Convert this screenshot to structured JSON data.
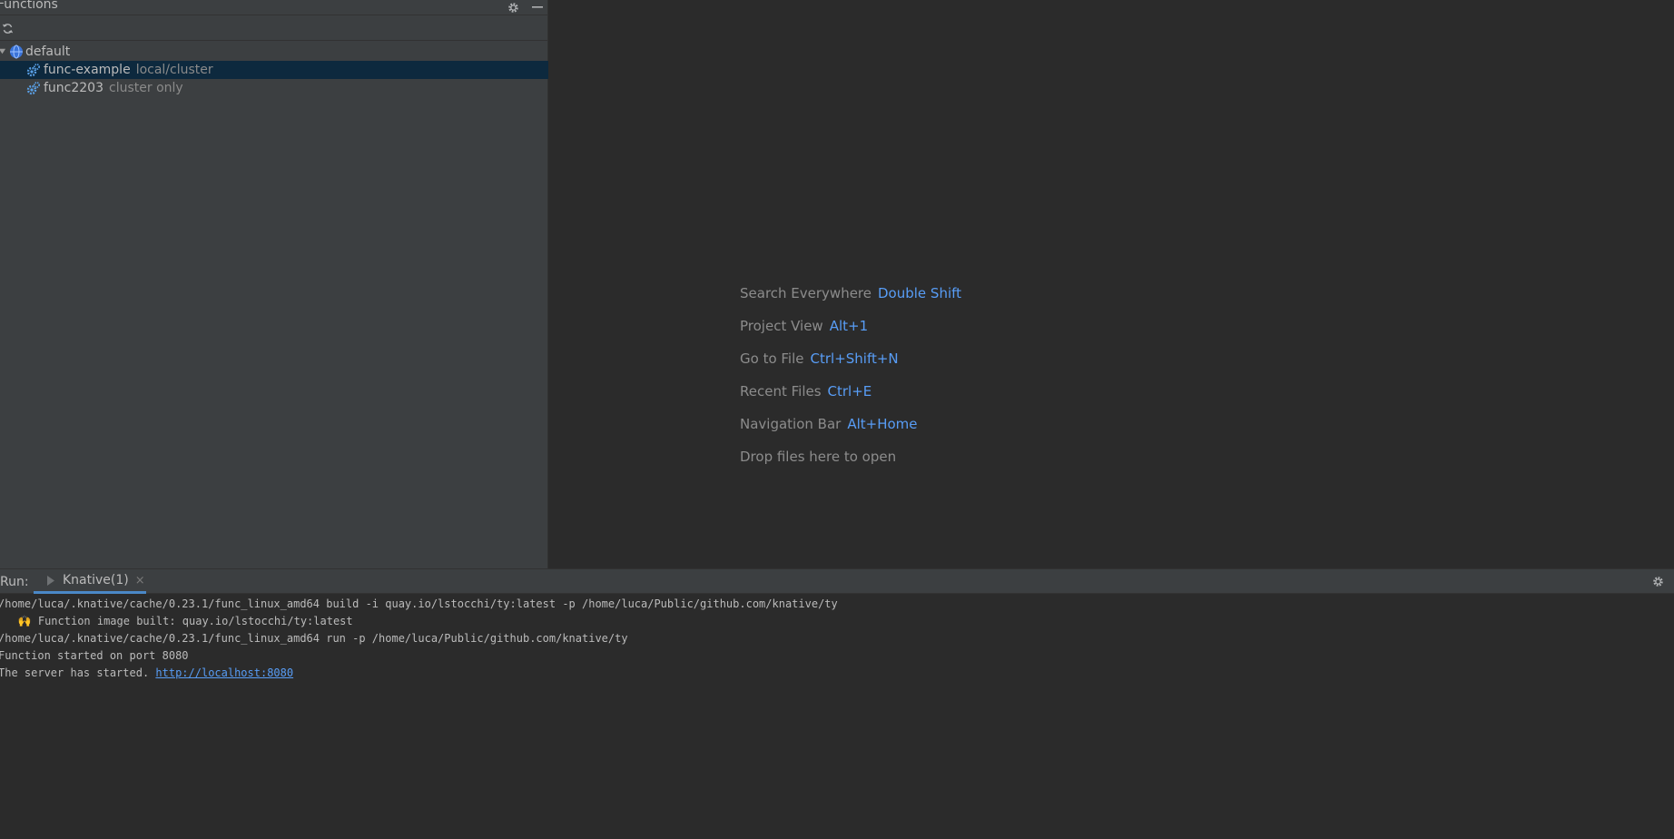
{
  "functions_panel": {
    "title": "Functions",
    "settings_icon": "gear-icon",
    "hide_icon": "minimize-icon",
    "toolbar": {
      "refresh_icon": "refresh-icon"
    },
    "tree": {
      "namespace": {
        "label": "default",
        "icon": "globe-icon",
        "expanded": true
      },
      "items": [
        {
          "label": "func-example",
          "hint": "local/cluster",
          "icon": "function-gear-icon",
          "selected": true
        },
        {
          "label": "func2203",
          "hint": "cluster only",
          "icon": "function-gear-icon",
          "selected": false
        }
      ]
    }
  },
  "editor_hints": [
    {
      "action": "Search Everywhere",
      "key": "Double Shift"
    },
    {
      "action": "Project View",
      "key": "Alt+1"
    },
    {
      "action": "Go to File",
      "key": "Ctrl+Shift+N"
    },
    {
      "action": "Recent Files",
      "key": "Ctrl+E"
    },
    {
      "action": "Navigation Bar",
      "key": "Alt+Home"
    },
    {
      "action": "Drop files here to open",
      "key": ""
    }
  ],
  "run_panel": {
    "label": "Run:",
    "tab": {
      "label": "Knative(1)",
      "icon": "run-icon",
      "close": "×"
    },
    "settings_icon": "gear-icon",
    "console": {
      "lines": [
        "/home/luca/.knative/cache/0.23.1/func_linux_amd64 build -i quay.io/lstocchi/ty:latest -p /home/luca/Public/github.com/knative/ty",
        "   🙌 Function image built: quay.io/lstocchi/ty:latest",
        "/home/luca/.knative/cache/0.23.1/func_linux_amd64 run -p /home/luca/Public/github.com/knative/ty",
        "Function started on port 8080"
      ],
      "server_line_prefix": "The server has started. ",
      "server_link": "http://localhost:8080"
    }
  },
  "colors": {
    "panel_bg": "#3c3f41",
    "editor_bg": "#2b2b2b",
    "selection_bg": "#0d293e",
    "accent": "#589df6",
    "hint_text": "#8a8a8a"
  }
}
